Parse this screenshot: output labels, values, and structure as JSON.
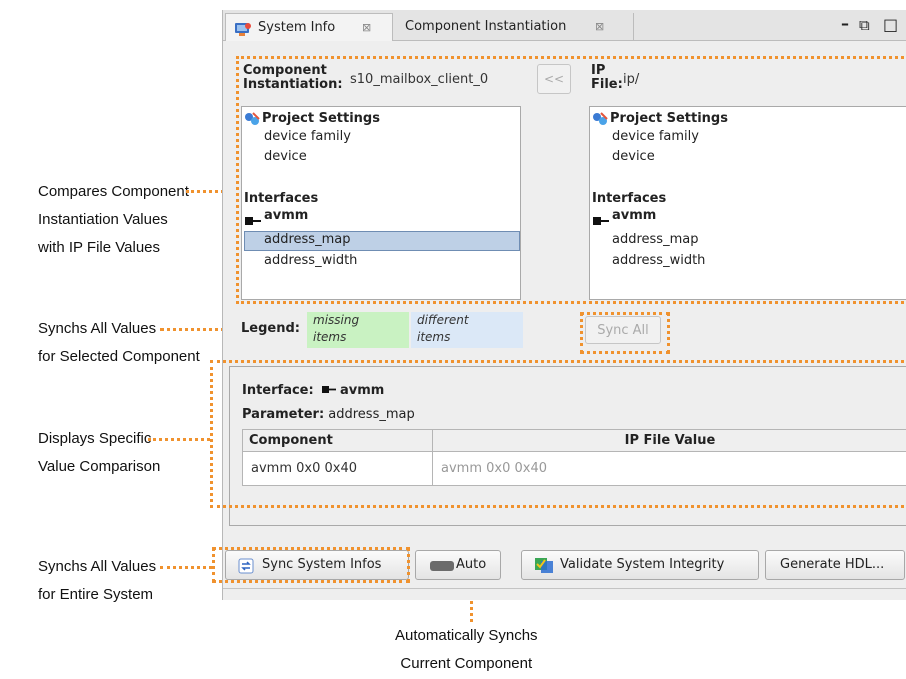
{
  "annotations": {
    "compare": [
      "Compares Component",
      "Instantiation Values",
      "with IP File Values"
    ],
    "sync_all": [
      "Synchs All Values",
      "for Selected Component"
    ],
    "displays": [
      "Displays Specific",
      "Value Comparison"
    ],
    "sync_system": [
      "Synchs All Values",
      "for Entire System"
    ],
    "auto": [
      "Automatically Synchs",
      "Current Component"
    ]
  },
  "tabs": [
    {
      "label": "System Info",
      "close": "⊠",
      "active": true
    },
    {
      "label": "Component Instantiation",
      "close": "⊠",
      "active": false
    }
  ],
  "window_controls": {
    "minimize": "–",
    "restore": "⧉",
    "maximize": "□"
  },
  "component": {
    "label_line1": "Component",
    "label_line2": "Instantiation:",
    "value": "s10_mailbox_client_0",
    "copy_button": "<<"
  },
  "ip_file": {
    "label_line1": "IP",
    "label_line2": "File:",
    "value": "ip/"
  },
  "left_tree": {
    "project_settings": "Project Settings",
    "device_family": "device family",
    "device": "device",
    "interfaces": "Interfaces",
    "avmm": "avmm",
    "address_map": "address_map",
    "address_width": "address_width"
  },
  "right_tree": {
    "project_settings": "Project Settings",
    "device_family": "device family",
    "device": "device",
    "interfaces": "Interfaces",
    "avmm": "avmm",
    "address_map": "address_map",
    "address_width": "address_width"
  },
  "legend": {
    "label": "Legend:",
    "missing_1": "missing",
    "missing_2": "items",
    "different_1": "different",
    "different_2": "items",
    "missing_color": "#c9f2c2",
    "different_color": "#dbe8f7"
  },
  "sync_all_button": "Sync All",
  "detail": {
    "interface_label": "Interface:",
    "interface_value": "avmm",
    "parameter_label": "Parameter:",
    "parameter_value": "address_map",
    "col_component": "Component",
    "col_ip": "IP File Value",
    "row_component": "avmm  0x0  0x40",
    "row_ip": "avmm  0x0  0x40"
  },
  "toolbar": {
    "sync_system": "Sync System Infos",
    "auto": "Auto",
    "validate": "Validate System Integrity",
    "generate": "Generate HDL..."
  }
}
